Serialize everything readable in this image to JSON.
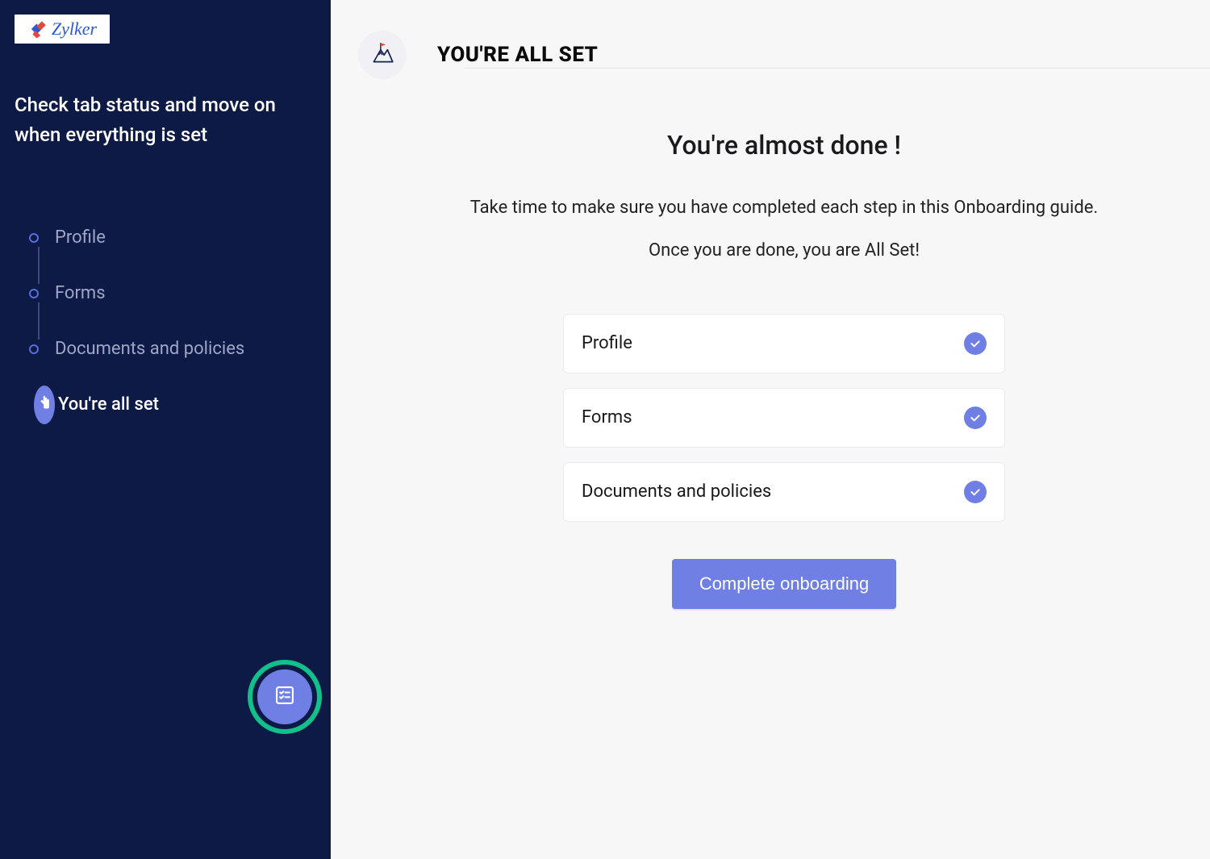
{
  "brand": {
    "name": "Zylker"
  },
  "sidebar": {
    "title": "Check tab status and move on when everything is set",
    "steps": [
      {
        "label": "Profile"
      },
      {
        "label": "Forms"
      },
      {
        "label": "Documents and policies"
      },
      {
        "label": "You're all set"
      }
    ]
  },
  "main": {
    "page_title": "YOU'RE ALL SET",
    "heading": "You're almost done !",
    "subtext_line1": "Take time to make sure you have completed each step in this Onboarding guide.",
    "subtext_line2": "Once you are done, you are All Set!",
    "checklist": [
      {
        "label": "Profile",
        "done": true
      },
      {
        "label": "Forms",
        "done": true
      },
      {
        "label": "Documents and policies",
        "done": true
      }
    ],
    "cta_label": "Complete onboarding"
  },
  "colors": {
    "accent": "#6f7fe3",
    "sidebar_bg": "#0d1a46",
    "ring": "#11c08a"
  }
}
